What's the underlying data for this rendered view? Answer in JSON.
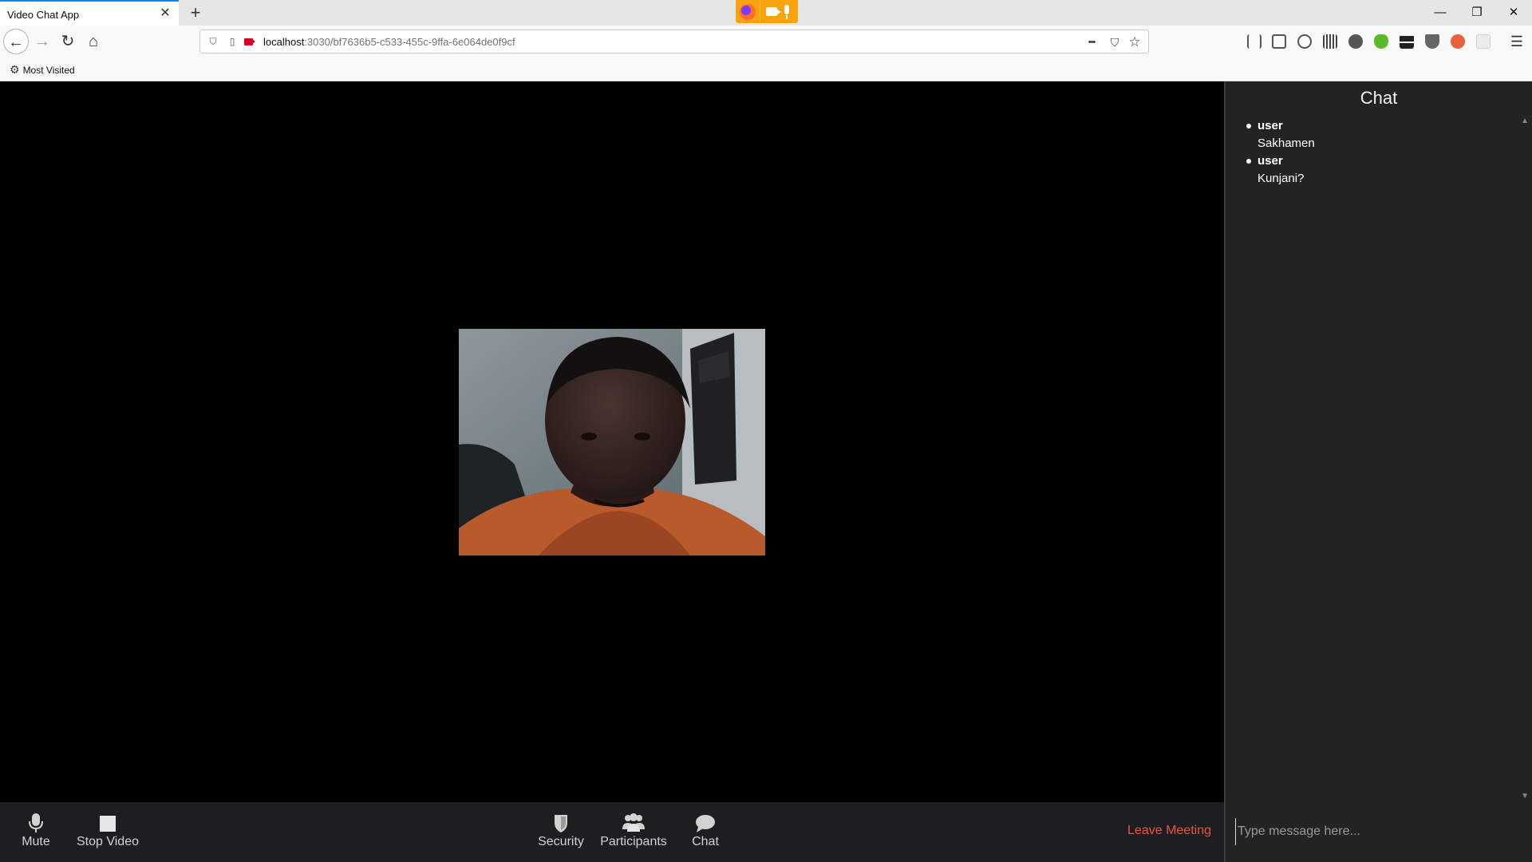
{
  "browser": {
    "tab_title": "Video Chat App",
    "tab_close": "✕",
    "new_tab": "+",
    "url_host": "localhost",
    "url_path": ":3030/bf7636b5-c533-455c-9ffa-6e064de0f9cf",
    "bookmark_label": "Most Visited",
    "window_controls": {
      "minimize": "—",
      "restore": "❐",
      "close": "✕"
    },
    "nav": {
      "back": "←",
      "forward": "→",
      "reload": "↻",
      "home": "⌂"
    },
    "url_actions": {
      "more": "•••",
      "pocket": "⛉",
      "bookmark_star": "☆"
    },
    "menu": "☰"
  },
  "meeting": {
    "controls": {
      "mute_label": "Mute",
      "stop_video_label": "Stop Video",
      "security_label": "Security",
      "participants_label": "Participants",
      "chat_label": "Chat",
      "leave_label": "Leave Meeting"
    }
  },
  "chat": {
    "title": "Chat",
    "messages": [
      {
        "user": "user",
        "text": "Sakhamen"
      },
      {
        "user": "user",
        "text": "Kunjani?"
      }
    ],
    "input_placeholder": "Type message here..."
  },
  "colors": {
    "leave": "#eb534b",
    "sharing_indicator": "#f7a40e",
    "controls_bg": "#1c1e20",
    "chat_bg": "#242324"
  },
  "icons": {
    "mute": "microphone-icon",
    "stop_video": "video-stop-icon",
    "security": "shield-icon",
    "participants": "people-icon",
    "chat": "speech-bubble-icon"
  }
}
